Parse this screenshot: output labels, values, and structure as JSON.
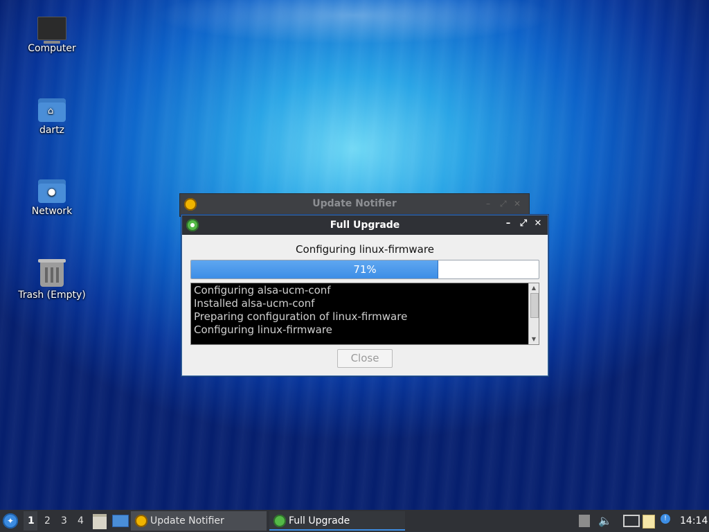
{
  "desktop": {
    "icons": [
      {
        "label": "Computer"
      },
      {
        "label": "dartz"
      },
      {
        "label": "Network"
      },
      {
        "label": "Trash (Empty)"
      }
    ]
  },
  "background_window": {
    "title": "Update Notifier",
    "controls": {
      "minimize": "–",
      "maximize": "⤢",
      "close": "✕"
    }
  },
  "dialog": {
    "title": "Full Upgrade",
    "controls": {
      "minimize": "–",
      "maximize": "⤢",
      "close": "✕"
    },
    "status": "Configuring linux-firmware",
    "progress": {
      "value": 0.71,
      "text": "71%"
    },
    "log": [
      "Configuring alsa-ucm-conf",
      "Installed alsa-ucm-conf",
      "Preparing configuration of linux-firmware",
      "Configuring linux-firmware"
    ],
    "close_label": "Close"
  },
  "taskbar": {
    "workspaces": [
      "1",
      "2",
      "3",
      "4"
    ],
    "active_workspace": "1",
    "tasks": [
      {
        "label": "Update Notifier"
      },
      {
        "label": "Full Upgrade"
      }
    ],
    "clock": "14:14"
  },
  "colors": {
    "accent": "#3d8ee6",
    "titlebar": "#2f3136",
    "progress_fill": "#3d8ee6"
  }
}
